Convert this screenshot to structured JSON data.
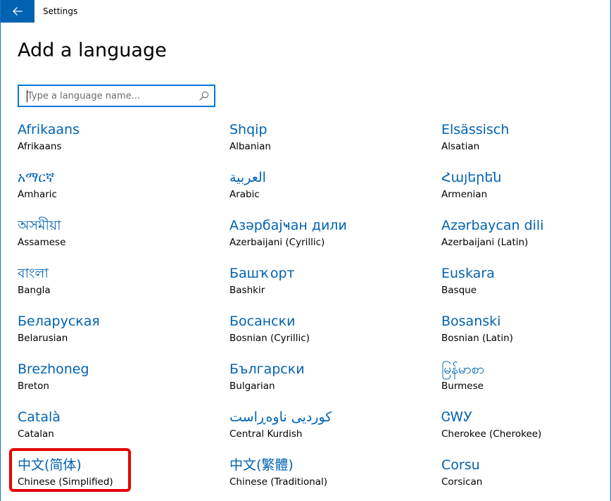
{
  "window": {
    "title": "Settings",
    "accent_color": "#0063b1"
  },
  "titlebar": {
    "back_icon": "back-arrow-icon"
  },
  "page": {
    "title": "Add a language"
  },
  "search": {
    "placeholder": "Type a language name...",
    "value": "",
    "icon": "search-icon"
  },
  "languages": [
    {
      "native": "Afrikaans",
      "english": "Afrikaans"
    },
    {
      "native": "Shqip",
      "english": "Albanian"
    },
    {
      "native": "Elsässisch",
      "english": "Alsatian"
    },
    {
      "native": "አማርኛ",
      "english": "Amharic"
    },
    {
      "native": "العربية",
      "english": "Arabic"
    },
    {
      "native": "Հայերեն",
      "english": "Armenian"
    },
    {
      "native": "অসমীয়া",
      "english": "Assamese"
    },
    {
      "native": "Азәрбајҹан дили",
      "english": "Azerbaijani (Cyrillic)"
    },
    {
      "native": "Azərbaycan dili",
      "english": "Azerbaijani (Latin)"
    },
    {
      "native": "বাংলা",
      "english": "Bangla"
    },
    {
      "native": "Башҡорт",
      "english": "Bashkir"
    },
    {
      "native": "Euskara",
      "english": "Basque"
    },
    {
      "native": "Беларуская",
      "english": "Belarusian"
    },
    {
      "native": "Босански",
      "english": "Bosnian (Cyrillic)"
    },
    {
      "native": "Bosanski",
      "english": "Bosnian (Latin)"
    },
    {
      "native": "Brezhoneg",
      "english": "Breton"
    },
    {
      "native": "Български",
      "english": "Bulgarian"
    },
    {
      "native": "မြန်မာစာ",
      "english": "Burmese"
    },
    {
      "native": "Català",
      "english": "Catalan"
    },
    {
      "native": "کوردیی ناوەڕاست",
      "english": "Central Kurdish"
    },
    {
      "native": "ᏣᎳᎩ",
      "english": "Cherokee (Cherokee)"
    },
    {
      "native": "中文(简体)",
      "english": "Chinese (Simplified)"
    },
    {
      "native": "中文(繁體)",
      "english": "Chinese (Traditional)"
    },
    {
      "native": "Corsu",
      "english": "Corsican"
    }
  ]
}
